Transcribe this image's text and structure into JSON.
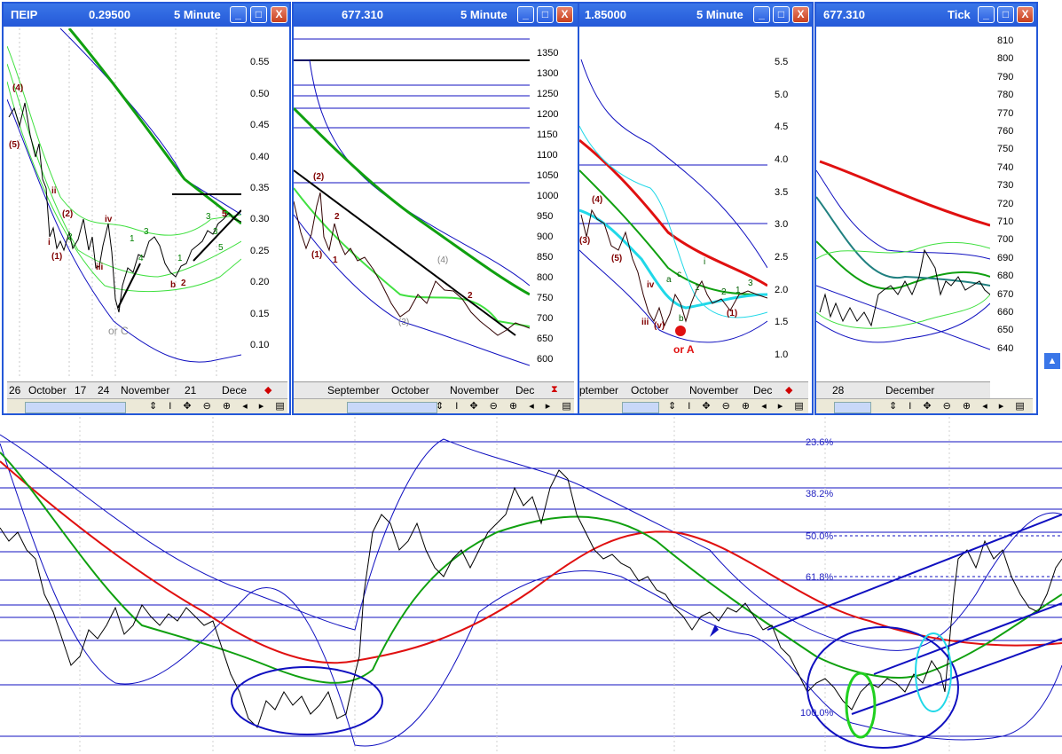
{
  "windows": [
    {
      "title": "ΠΕΙΡ",
      "price": "0.29500",
      "interval": "5 Minute",
      "y_ticks": [
        "0.55",
        "0.50",
        "0.45",
        "0.40",
        "0.35",
        "0.30",
        "0.25",
        "0.20",
        "0.15",
        "0.10"
      ],
      "date_labels": [
        "26",
        "October",
        "17",
        "24",
        "November",
        "21",
        "Dece"
      ]
    },
    {
      "title": "",
      "price": "677.310",
      "interval": "5 Minute",
      "y_ticks": [
        "1350",
        "1300",
        "1250",
        "1200",
        "1150",
        "1100",
        "1050",
        "1000",
        "950",
        "900",
        "850",
        "800",
        "750",
        "700",
        "650",
        "600"
      ],
      "date_labels": [
        "September",
        "October",
        "November",
        "Dec"
      ]
    },
    {
      "title": "",
      "price": "1.85000",
      "interval": "5 Minute",
      "y_ticks": [
        "5.5",
        "5.0",
        "4.5",
        "4.0",
        "3.5",
        "3.0",
        "2.5",
        "2.0",
        "1.5",
        "1.0"
      ],
      "date_labels": [
        "ptember",
        "October",
        "November",
        "Dec"
      ]
    },
    {
      "title": "",
      "price": "677.310",
      "interval": "Tick",
      "y_ticks": [
        "810",
        "800",
        "790",
        "780",
        "770",
        "760",
        "750",
        "740",
        "730",
        "720",
        "710",
        "700",
        "690",
        "680",
        "670",
        "660",
        "650",
        "640"
      ],
      "date_labels": [
        "28",
        "December"
      ]
    }
  ],
  "window_buttons": {
    "minimize": "_",
    "maximize": "□",
    "close": "X"
  },
  "toolbar_glyphs": "⇕ I ✥ ⊖ ⊕ ◂ ▸ ▤",
  "wave_labels": {
    "w1": [
      "(4)",
      "(5)",
      "ii",
      "i",
      "(2)",
      "(1)",
      "iv",
      "iii",
      "2",
      "1",
      "3",
      "3",
      "4",
      "5",
      "b",
      "2",
      "1",
      "3",
      "5",
      "or C"
    ],
    "w2": [
      "(2)",
      "(1)",
      "2",
      "1",
      "(3)",
      "(4)",
      "2"
    ],
    "w3": [
      "(4)",
      "(3)",
      "(5)",
      "iv",
      "iii",
      "(v)",
      "a",
      "c",
      "b",
      "i",
      "1",
      "2",
      "1",
      "(1)",
      "3",
      "or A"
    ]
  },
  "fib_levels": [
    "23.6%",
    "38.2%",
    "50.0%",
    "61.8%",
    "100.0%"
  ],
  "colors": {
    "titlebar": "#2458d8",
    "price": "#000000",
    "ma_red": "#e01010",
    "ma_green": "#10a010",
    "band_blue": "#1010c0",
    "light_green": "#40e040",
    "cyan": "#20d8e8"
  },
  "chart_data": {
    "type": "line",
    "title": "",
    "series": [
      {
        "values": [
          0.52,
          0.4,
          0.29,
          0.26,
          0.22,
          0.16,
          0.21,
          0.25,
          0.27,
          0.22,
          0.2,
          0.25,
          0.29,
          0.31,
          0.3
        ]
      },
      {
        "values": [
          1000,
          930,
          880,
          860,
          840,
          790,
          760,
          740,
          755,
          780,
          770,
          750,
          720,
          690,
          670,
          680
        ]
      },
      {
        "values": [
          3.2,
          3.0,
          2.9,
          2.5,
          2.0,
          1.6,
          1.7,
          2.2,
          2.3,
          1.9,
          1.8,
          2.0,
          2.1,
          2.0
        ]
      },
      {
        "values": [
          672,
          678,
          664,
          668,
          682,
          688,
          696,
          688,
          690,
          694,
          686,
          684,
          680,
          676
        ]
      }
    ]
  }
}
